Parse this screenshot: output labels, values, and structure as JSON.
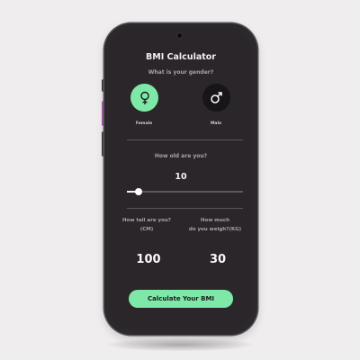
{
  "app": {
    "title": "BMI Calculator"
  },
  "gender": {
    "question": "What is your gender?",
    "options": [
      {
        "label": "Female",
        "icon": "female-icon",
        "selected": true
      },
      {
        "label": "Male",
        "icon": "male-icon",
        "selected": false
      }
    ]
  },
  "age": {
    "question": "How old are you?",
    "value": "10",
    "slider_fraction": 0.1
  },
  "height": {
    "label_line1": "How tall are you?",
    "label_line2": "(CM)",
    "value": "100"
  },
  "weight": {
    "label_line1": "How much",
    "label_line2": "do you weigh?(KG)",
    "value": "30"
  },
  "calculate_button": {
    "label": "Calculate Your BMI"
  },
  "colors": {
    "accent": "#7ee8a8",
    "screen_background": "#2a2629",
    "page_background": "#efedee"
  }
}
